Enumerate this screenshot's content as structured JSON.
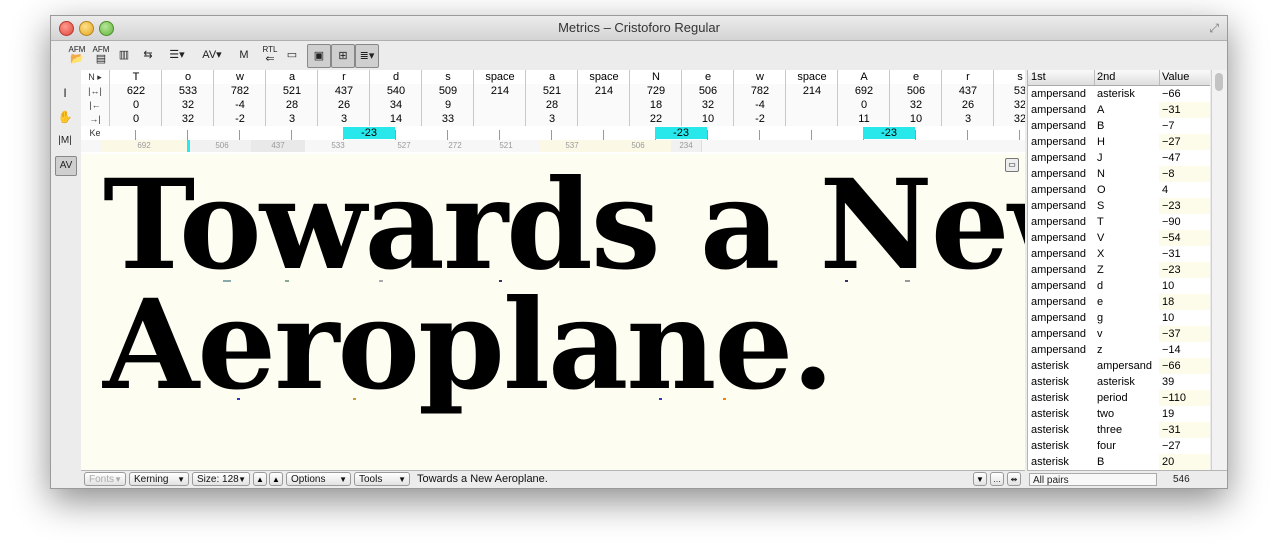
{
  "window": {
    "title": "Metrics – Cristoforo Regular",
    "resize_icon": "⤢"
  },
  "toolbar": {
    "buttons": [
      {
        "name": "open-afm-icon",
        "label": "AFM",
        "icon": "📂"
      },
      {
        "name": "save-afm-icon",
        "label": "AFM",
        "icon": "▤"
      },
      {
        "name": "paste-icon",
        "label": "",
        "icon": "▥"
      },
      {
        "name": "import-icon",
        "label": "",
        "icon": "⇆"
      },
      {
        "name": "list-menu-icon",
        "label": "",
        "icon": "☰▾"
      },
      {
        "name": "auto-kern-icon",
        "label": "",
        "icon": "AV▾"
      },
      {
        "name": "metrics-m-icon",
        "label": "",
        "icon": "M"
      },
      {
        "name": "rtl-icon",
        "label": "RTL",
        "icon": "⇐"
      },
      {
        "name": "toggle-ruler-icon",
        "label": "",
        "icon": "▭"
      },
      {
        "name": "show-metrics-icon",
        "label": "",
        "icon": "▣"
      },
      {
        "name": "show-fields-icon",
        "label": "",
        "icon": "⊞"
      },
      {
        "name": "show-pairs-icon",
        "label": "",
        "icon": "≣▾"
      }
    ]
  },
  "left_tools": [
    {
      "name": "text-tool-icon",
      "icon": "I"
    },
    {
      "name": "hand-tool-icon",
      "icon": "✋"
    },
    {
      "name": "metrics-tool-icon",
      "icon": "|M|"
    },
    {
      "name": "kern-tool-icon",
      "icon": "AV"
    }
  ],
  "metrics": {
    "row_headers": [
      "N ▸",
      "|↔|",
      "|←",
      "→|",
      "Ke"
    ],
    "glyphs": [
      "T",
      "o",
      "w",
      "a",
      "r",
      "d",
      "s",
      "space",
      "a",
      "space",
      "N",
      "e",
      "w",
      "space",
      "A",
      "e",
      "r",
      "s"
    ],
    "widths": [
      "622",
      "533",
      "782",
      "521",
      "437",
      "540",
      "509",
      "214",
      "521",
      "214",
      "729",
      "506",
      "782",
      "214",
      "692",
      "506",
      "437",
      "53"
    ],
    "lsb": [
      "0",
      "32",
      "-4",
      "28",
      "26",
      "34",
      "9",
      "",
      "28",
      "",
      "18",
      "32",
      "-4",
      "",
      "0",
      "32",
      "26",
      "32"
    ],
    "rsb": [
      "0",
      "32",
      "-2",
      "3",
      "3",
      "14",
      "33",
      "",
      "3",
      "",
      "22",
      "10",
      "-2",
      "",
      "11",
      "10",
      "3",
      "32"
    ],
    "kerns": [
      {
        "after": 4,
        "value": "-23"
      },
      {
        "after": 10,
        "value": "-23"
      },
      {
        "after": 14,
        "value": "-23"
      }
    ],
    "ruler_values": [
      "692",
      "506",
      "437",
      "533",
      "527",
      "272",
      "521",
      "537",
      "506",
      "234"
    ]
  },
  "sample": {
    "line1": "Towards a New",
    "line2": "Aeroplane."
  },
  "bottombar": {
    "fonts_label": "Fonts",
    "kerning_label": "Kerning",
    "size_label": "Size: 128",
    "options_label": "Options",
    "tools_label": "Tools",
    "sample_text": "Towards a New Aeroplane."
  },
  "pairs": {
    "headers": {
      "first": "1st",
      "second": "2nd",
      "value": "Value"
    },
    "rows": [
      {
        "first": "ampersand",
        "second": "asterisk",
        "value": "-66"
      },
      {
        "first": "ampersand",
        "second": "A",
        "value": "-31"
      },
      {
        "first": "ampersand",
        "second": "B",
        "value": "-7"
      },
      {
        "first": "ampersand",
        "second": "H",
        "value": "-27"
      },
      {
        "first": "ampersand",
        "second": "J",
        "value": "-47"
      },
      {
        "first": "ampersand",
        "second": "N",
        "value": "-8"
      },
      {
        "first": "ampersand",
        "second": "O",
        "value": "4"
      },
      {
        "first": "ampersand",
        "second": "S",
        "value": "-23"
      },
      {
        "first": "ampersand",
        "second": "T",
        "value": "-90"
      },
      {
        "first": "ampersand",
        "second": "V",
        "value": "-54"
      },
      {
        "first": "ampersand",
        "second": "X",
        "value": "-31"
      },
      {
        "first": "ampersand",
        "second": "Z",
        "value": "-23"
      },
      {
        "first": "ampersand",
        "second": "d",
        "value": "10"
      },
      {
        "first": "ampersand",
        "second": "e",
        "value": "18"
      },
      {
        "first": "ampersand",
        "second": "g",
        "value": "10"
      },
      {
        "first": "ampersand",
        "second": "v",
        "value": "-37"
      },
      {
        "first": "ampersand",
        "second": "z",
        "value": "-14"
      },
      {
        "first": "asterisk",
        "second": "ampersand",
        "value": "-66"
      },
      {
        "first": "asterisk",
        "second": "asterisk",
        "value": "39"
      },
      {
        "first": "asterisk",
        "second": "period",
        "value": "-110"
      },
      {
        "first": "asterisk",
        "second": "two",
        "value": "19"
      },
      {
        "first": "asterisk",
        "second": "three",
        "value": "-31"
      },
      {
        "first": "asterisk",
        "second": "four",
        "value": "-27"
      },
      {
        "first": "asterisk",
        "second": "B",
        "value": "20"
      }
    ],
    "filter_label": "All pairs",
    "count": "546"
  },
  "colors": {
    "kern_highlight": "#29e8ec",
    "canvas_bg": "#fdfdf1",
    "alt_row": "#fdfcea"
  }
}
